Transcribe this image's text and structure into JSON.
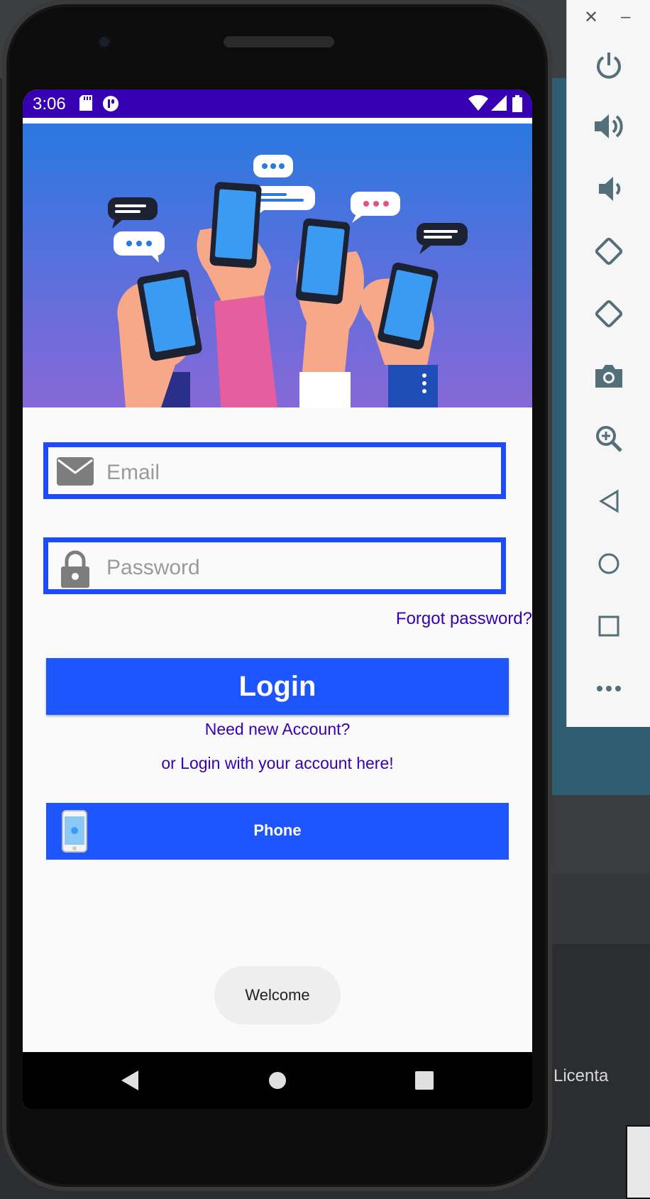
{
  "status_bar": {
    "time": "3:06"
  },
  "login_form": {
    "email_placeholder": "Email",
    "password_placeholder": "Password",
    "forgot_password": "Forgot password?",
    "login_button": "Login",
    "need_account": "Need new Account?",
    "login_with_account": "or Login with your account here!",
    "phone_button": "Phone"
  },
  "toast": {
    "message": "Welcome"
  },
  "background": {
    "window_label": "Licenta"
  },
  "emulator_panel": {
    "controls": [
      "close-icon",
      "minimize-icon",
      "power-icon",
      "volume-up-icon",
      "volume-down-icon",
      "rotate-left-icon",
      "rotate-right-icon",
      "camera-icon",
      "zoom-icon",
      "back-icon",
      "home-icon",
      "overview-icon",
      "more-icon"
    ]
  },
  "colors": {
    "status_bar": "#3700b3",
    "accent_blue": "#1d55ff",
    "link_purple": "#3700b3",
    "hero_top": "#2a78e0",
    "hero_bottom": "#8868d8"
  }
}
